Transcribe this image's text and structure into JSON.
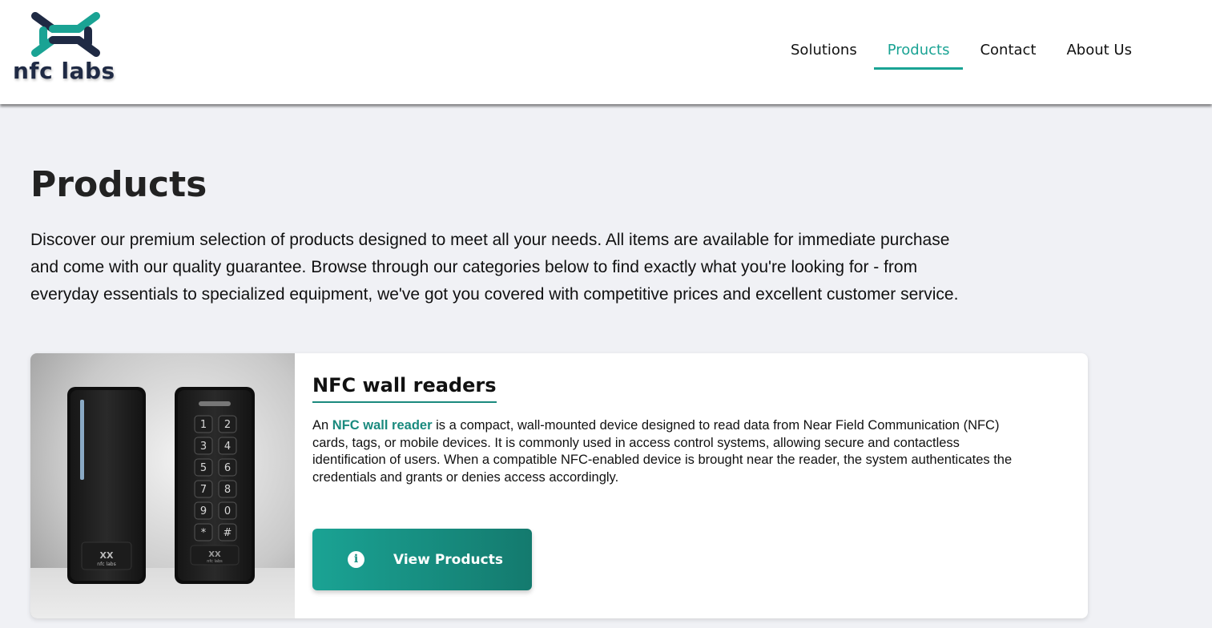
{
  "brand": {
    "name": "nfc labs",
    "colors": {
      "teal": "#1aa394",
      "navy": "#1f2a44"
    }
  },
  "nav": {
    "items": [
      {
        "label": "Solutions",
        "active": false
      },
      {
        "label": "Products",
        "active": true
      },
      {
        "label": "Contact",
        "active": false
      },
      {
        "label": "About Us",
        "active": false
      }
    ]
  },
  "page": {
    "title": "Products",
    "intro": "Discover our premium selection of products designed to meet all your needs. All items are available for immediate purchase and come with our quality guarantee. Browse through our categories below to find exactly what you're looking for - from everyday essentials to specialized equipment, we've got you covered with competitive prices and excellent customer service."
  },
  "product_card": {
    "title": "NFC wall readers",
    "desc_prefix": "An ",
    "desc_highlight": "NFC wall reader",
    "desc_rest": " is a compact, wall-mounted device designed to read data from Near Field Communication (NFC) cards, tags, or mobile devices. It is commonly used in access control systems, allowing secure and contactless identification of users. When a compatible NFC-enabled device is brought near the reader, the system authenticates the credentials and grants or denies access accordingly.",
    "button": {
      "label": "View Products",
      "icon": "info-icon"
    },
    "image": {
      "alt": "Two black NFC wall readers, one with keypad",
      "keypad_keys": [
        "1",
        "2",
        "3",
        "4",
        "5",
        "6",
        "7",
        "8",
        "9",
        "0",
        "*",
        "#"
      ],
      "device_logo_text": "nfc labs"
    }
  }
}
